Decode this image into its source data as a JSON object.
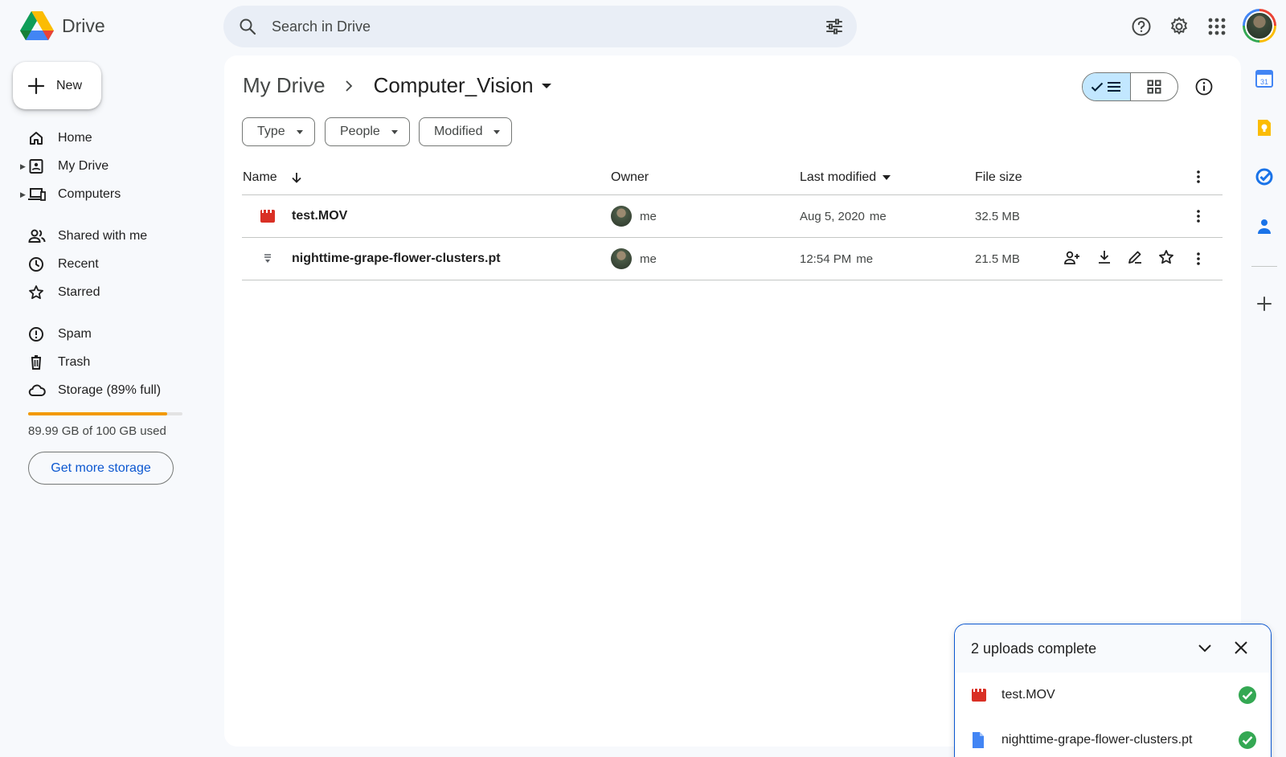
{
  "app": {
    "name": "Drive"
  },
  "search": {
    "placeholder": "Search in Drive"
  },
  "sidebar": {
    "new_label": "New",
    "items": [
      {
        "label": "Home"
      },
      {
        "label": "My Drive"
      },
      {
        "label": "Computers"
      },
      {
        "label": "Shared with me"
      },
      {
        "label": "Recent"
      },
      {
        "label": "Starred"
      },
      {
        "label": "Spam"
      },
      {
        "label": "Trash"
      },
      {
        "label": "Storage (89% full)"
      }
    ],
    "storage": {
      "used_fraction": 0.8999,
      "used_text": "89.99 GB of 100 GB used",
      "button_label": "Get more storage"
    }
  },
  "breadcrumb": {
    "root": "My Drive",
    "current": "Computer_Vision"
  },
  "filters": {
    "type": "Type",
    "people": "People",
    "modified": "Modified"
  },
  "table": {
    "columns": {
      "name": "Name",
      "owner": "Owner",
      "modified": "Last modified",
      "size": "File size"
    },
    "rows": [
      {
        "name": "test.MOV",
        "owner": "me",
        "modified": "Aug 5, 2020",
        "modified_by": "me",
        "size": "32.5 MB"
      },
      {
        "name": "nighttime-grape-flower-clusters.pt",
        "owner": "me",
        "modified": "12:54 PM",
        "modified_by": "me",
        "size": "21.5 MB"
      }
    ]
  },
  "uploads": {
    "title": "2 uploads complete",
    "items": [
      {
        "name": "test.MOV"
      },
      {
        "name": "nighttime-grape-flower-clusters.pt"
      }
    ]
  },
  "colors": {
    "accent": "#0b57d0",
    "storage_warn": "#f29900",
    "video_red": "#d93025",
    "success": "#34a853"
  }
}
